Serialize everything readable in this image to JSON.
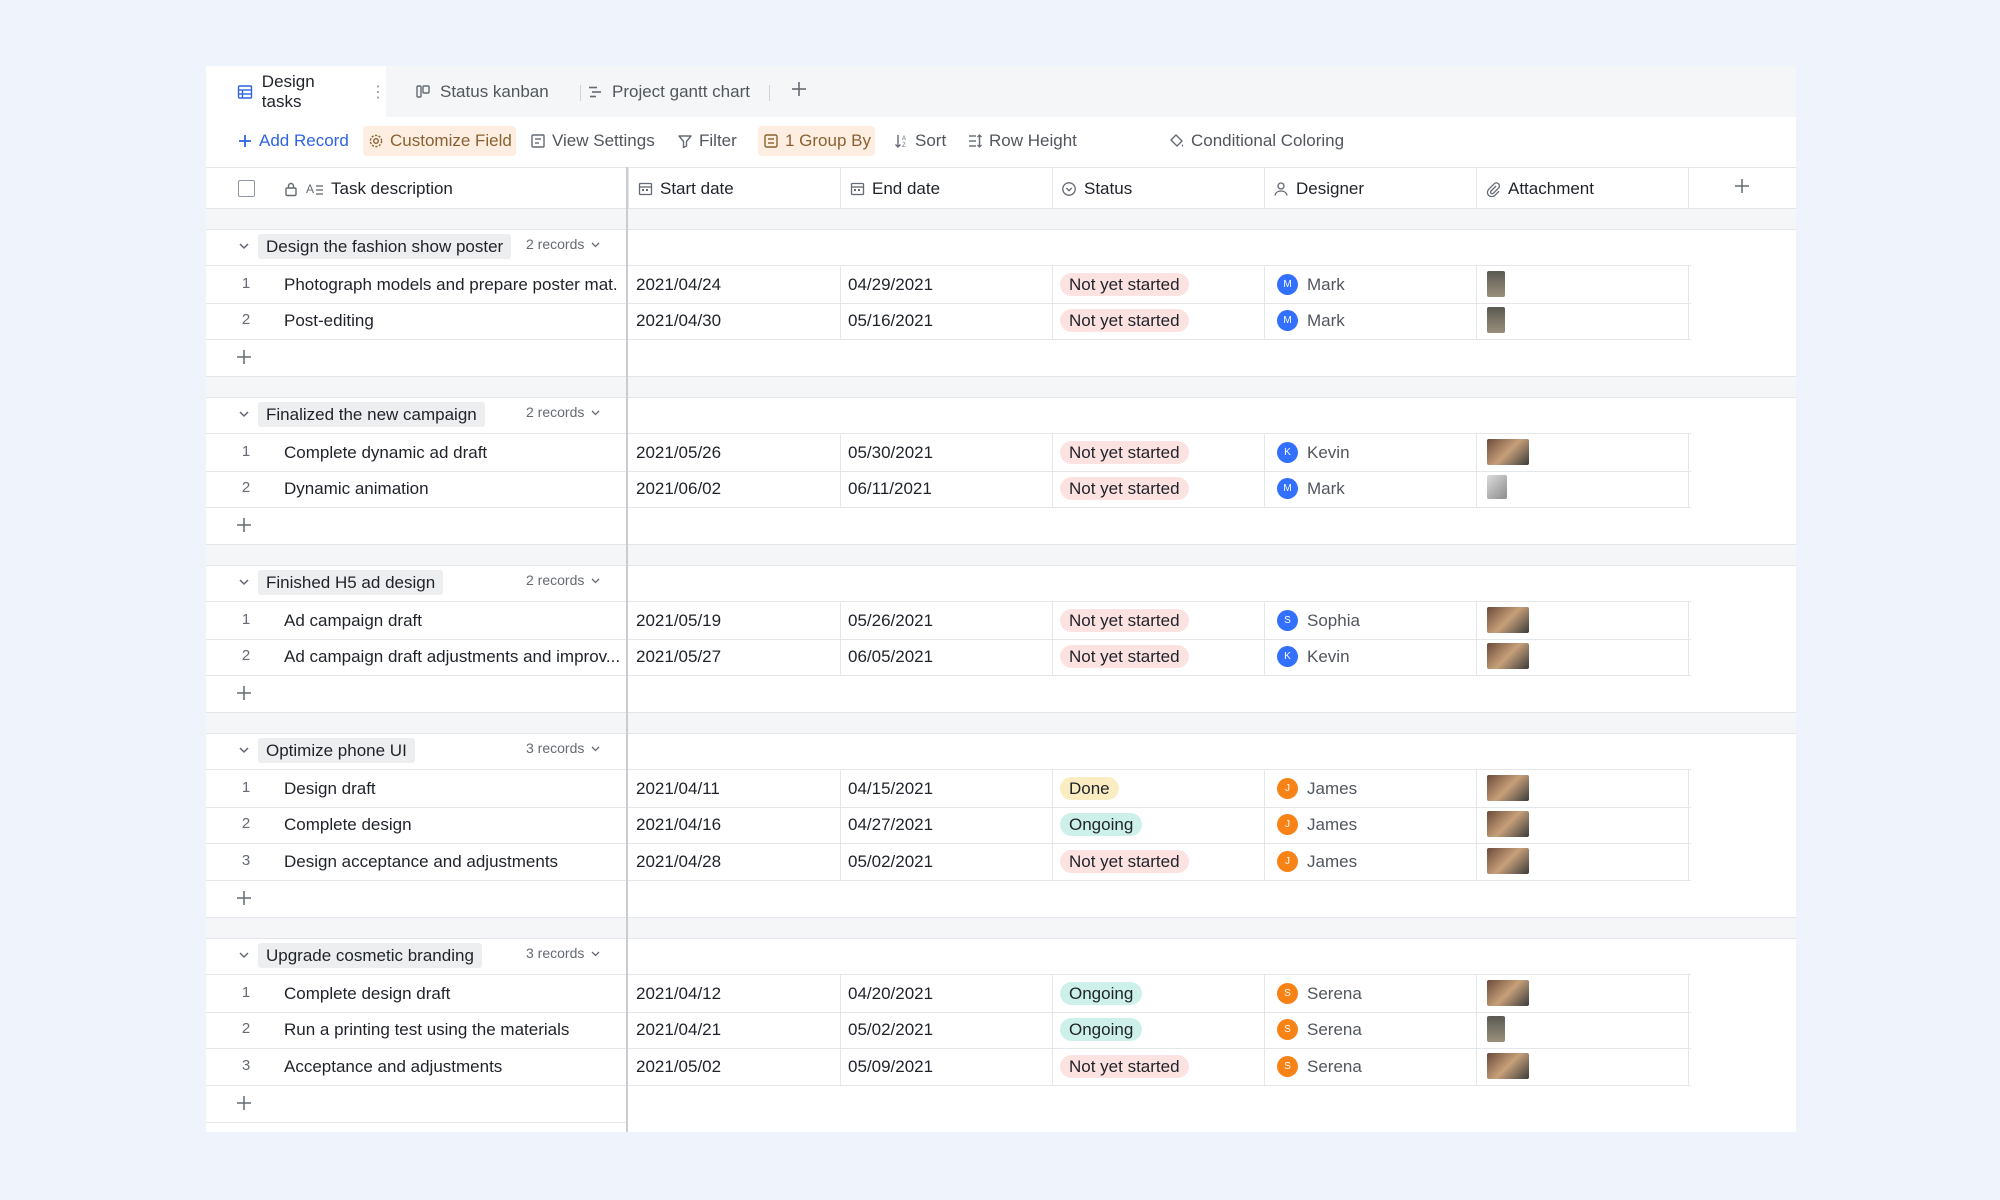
{
  "tabs": [
    {
      "label": "Design tasks",
      "icon": "grid-table-icon",
      "active": true
    },
    {
      "label": "Status kanban",
      "icon": "kanban-icon",
      "active": false
    },
    {
      "label": "Project gantt chart",
      "icon": "gantt-icon",
      "active": false
    }
  ],
  "toolbar": {
    "add_record": "Add Record",
    "customize_field": "Customize Field",
    "view_settings": "View Settings",
    "filter": "Filter",
    "group_by": "1 Group By",
    "sort": "Sort",
    "row_height": "Row Height",
    "conditional_coloring": "Conditional Coloring"
  },
  "columns": {
    "task": "Task description",
    "start": "Start date",
    "end": "End date",
    "status": "Status",
    "designer": "Designer",
    "attachment": "Attachment"
  },
  "colors": {
    "accent": "#2e64e1",
    "status_not_started_bg": "#fde2e2",
    "status_done_bg": "#faedc2",
    "status_ongoing_bg": "#cdf1ea",
    "avatar_blue": "#3370ff",
    "avatar_orange": "#f78216"
  },
  "groups": [
    {
      "label": "Design the fashion show poster",
      "count": "2 records",
      "rows": [
        {
          "num": "1",
          "task": "Photograph models and prepare poster mat...",
          "start": "2021/04/24",
          "end": "04/29/2021",
          "status": "Not yet started",
          "designer": "Mark",
          "initial": "M",
          "avatar": "blue",
          "thumb": "portrait"
        },
        {
          "num": "2",
          "task": "Post-editing",
          "start": "2021/04/30",
          "end": "05/16/2021",
          "status": "Not yet started",
          "designer": "Mark",
          "initial": "M",
          "avatar": "blue",
          "thumb": "portrait"
        }
      ]
    },
    {
      "label": "Finalized the new campaign",
      "count": "2 records",
      "rows": [
        {
          "num": "1",
          "task": "Complete dynamic ad draft",
          "start": "2021/05/26",
          "end": "05/30/2021",
          "status": "Not yet started",
          "designer": "Kevin",
          "initial": "K",
          "avatar": "blue",
          "thumb": "wide"
        },
        {
          "num": "2",
          "task": "Dynamic animation",
          "start": "2021/06/02",
          "end": "06/11/2021",
          "status": "Not yet started",
          "designer": "Mark",
          "initial": "M",
          "avatar": "blue",
          "thumb": "small"
        }
      ]
    },
    {
      "label": "Finished H5 ad design",
      "count": "2 records",
      "rows": [
        {
          "num": "1",
          "task": "Ad campaign draft",
          "start": "2021/05/19",
          "end": "05/26/2021",
          "status": "Not yet started",
          "designer": "Sophia",
          "initial": "S",
          "avatar": "blue",
          "thumb": "wide"
        },
        {
          "num": "2",
          "task": "Ad campaign draft adjustments and improv...",
          "start": "2021/05/27",
          "end": "06/05/2021",
          "status": "Not yet started",
          "designer": "Kevin",
          "initial": "K",
          "avatar": "blue",
          "thumb": "wide"
        }
      ]
    },
    {
      "label": "Optimize phone UI",
      "count": "3 records",
      "rows": [
        {
          "num": "1",
          "task": "Design draft",
          "start": "2021/04/11",
          "end": "04/15/2021",
          "status": "Done",
          "designer": "James",
          "initial": "J",
          "avatar": "orange",
          "thumb": "wide"
        },
        {
          "num": "2",
          "task": "Complete design",
          "start": "2021/04/16",
          "end": "04/27/2021",
          "status": "Ongoing",
          "designer": "James",
          "initial": "J",
          "avatar": "orange",
          "thumb": "wide"
        },
        {
          "num": "3",
          "task": "Design acceptance and adjustments",
          "start": "2021/04/28",
          "end": "05/02/2021",
          "status": "Not yet started",
          "designer": "James",
          "initial": "J",
          "avatar": "orange",
          "thumb": "wide"
        }
      ]
    },
    {
      "label": "Upgrade cosmetic branding",
      "count": "3 records",
      "rows": [
        {
          "num": "1",
          "task": "Complete design draft",
          "start": "2021/04/12",
          "end": "04/20/2021",
          "status": "Ongoing",
          "designer": "Serena",
          "initial": "S",
          "avatar": "orange",
          "thumb": "wide"
        },
        {
          "num": "2",
          "task": "Run a printing test using the materials",
          "start": "2021/04/21",
          "end": "05/02/2021",
          "status": "Ongoing",
          "designer": "Serena",
          "initial": "S",
          "avatar": "orange",
          "thumb": "portrait"
        },
        {
          "num": "3",
          "task": "Acceptance and adjustments",
          "start": "2021/05/02",
          "end": "05/09/2021",
          "status": "Not yet started",
          "designer": "Serena",
          "initial": "S",
          "avatar": "orange",
          "thumb": "wide"
        }
      ]
    }
  ]
}
